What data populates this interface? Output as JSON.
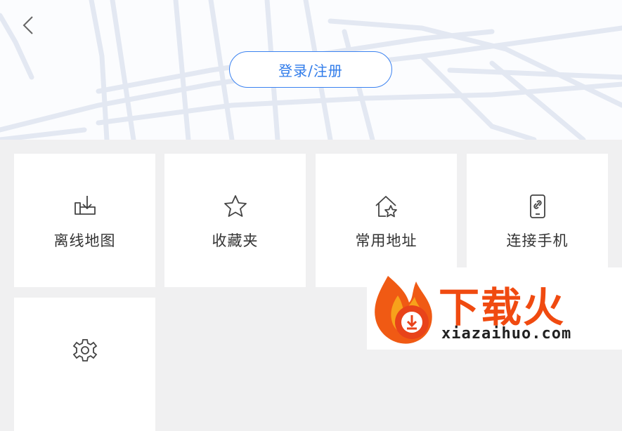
{
  "header": {
    "login_label": "登录/注册"
  },
  "tiles": [
    {
      "label": "离线地图",
      "icon": "offline-download-icon"
    },
    {
      "label": "收藏夹",
      "icon": "star-icon"
    },
    {
      "label": "常用地址",
      "icon": "home-star-icon"
    },
    {
      "label": "连接手机",
      "icon": "phone-link-icon"
    },
    {
      "label": "",
      "icon": "gear-icon"
    }
  ],
  "watermark": {
    "brand_cn": "下载火",
    "brand_en": "xiazaihuo.com"
  },
  "colors": {
    "accent": "#3b82f0",
    "background": "#f0f0f1",
    "brand": "#f04a10"
  }
}
